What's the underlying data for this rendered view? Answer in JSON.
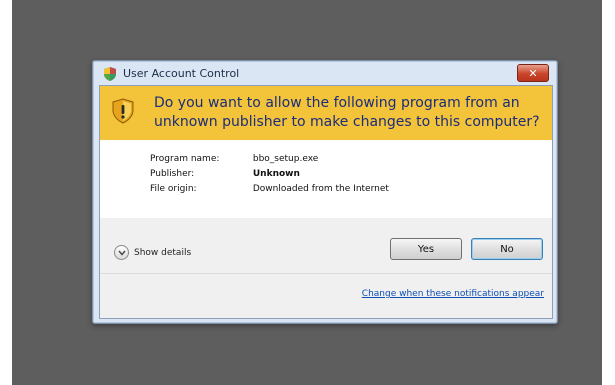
{
  "window": {
    "title": "User Account Control",
    "close_label": "✕"
  },
  "banner": {
    "question": "Do you want to allow the following program from an unknown publisher to make changes to this computer?"
  },
  "details": {
    "rows": [
      {
        "label": "Program name:",
        "value": "bbo_setup.exe"
      },
      {
        "label": "Publisher:",
        "value": "Unknown"
      },
      {
        "label": "File origin:",
        "value": "Downloaded from the Internet"
      }
    ]
  },
  "actions": {
    "show_details_label": "Show details",
    "yes_label": "Yes",
    "no_label": "No",
    "change_link": "Change when these notifications appear"
  },
  "colors": {
    "backdrop": "#5e5e5e",
    "banner": "#f3c33a",
    "question_text": "#1a2d7c",
    "link": "#0d4fb3",
    "close_button": "#c9452b"
  },
  "icons": {
    "title": "uac-shield-icon",
    "banner": "warning-shield-icon",
    "expand": "chevron-down-icon"
  }
}
